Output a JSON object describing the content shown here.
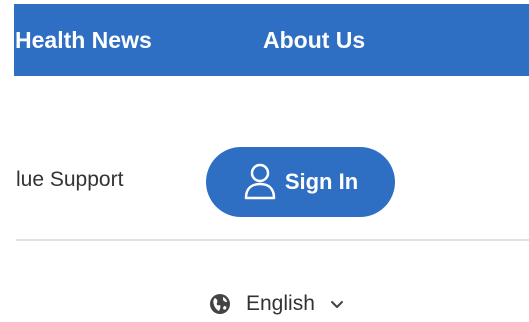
{
  "nav": {
    "items": [
      {
        "label": "Health News"
      },
      {
        "label": "About Us"
      }
    ]
  },
  "account_bar": {
    "support_link": "lue Support",
    "signin_label": "Sign In",
    "signin_icon": "user-icon"
  },
  "language": {
    "label": "English",
    "icon": "globe-icon",
    "dropdown_icon": "chevron-down-icon"
  },
  "colors": {
    "brand_blue": "#2f6fc3",
    "text_dark": "#333333",
    "divider": "#e2e2e2"
  }
}
